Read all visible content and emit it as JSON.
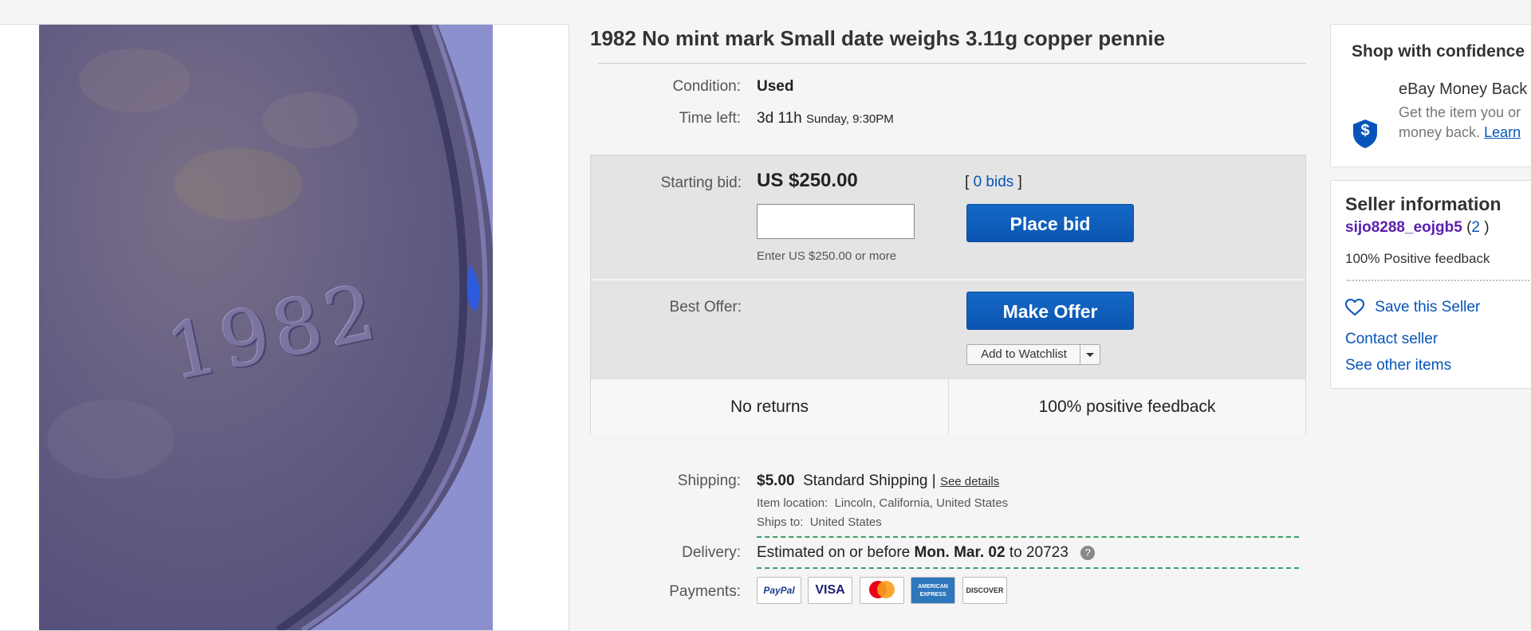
{
  "item": {
    "title": "1982 No mint mark Small date weighs 3.11g copper pennie",
    "photo_text": "1982",
    "condition_label": "Condition:",
    "condition_value": "Used",
    "time_left_label": "Time left:",
    "time_left_value": "3d 11h",
    "time_left_end": "Sunday, 9:30PM"
  },
  "bidding": {
    "starting_bid_label": "Starting bid:",
    "starting_bid_value": "US $250.00",
    "bids_open": "[",
    "bids_link": "0 bids",
    "bids_close": "]",
    "input_hint": "Enter US $250.00 or more",
    "place_bid_label": "Place bid",
    "best_offer_label": "Best Offer:",
    "make_offer_label": "Make Offer",
    "watchlist_label": "Add to Watchlist",
    "returns_text": "No returns",
    "feedback_text": "100% positive feedback"
  },
  "shipping": {
    "shipping_label": "Shipping:",
    "cost": "$5.00",
    "method": "Standard Shipping",
    "separator": "|",
    "details_link": "See details",
    "location_label": "Item location:",
    "location_value": "Lincoln, California, United States",
    "ships_to_label": "Ships to:",
    "ships_to_value": "United States",
    "delivery_label": "Delivery:",
    "delivery_prefix": "Estimated on or before",
    "delivery_date": "Mon. Mar. 02",
    "delivery_to": "to 20723",
    "help_glyph": "?",
    "payments_label": "Payments:",
    "payment_methods": [
      "PayPal",
      "VISA",
      "mastercard",
      "AMERICAN EXPRESS",
      "DISCOVER"
    ]
  },
  "confidence": {
    "heading": "Shop with confidence",
    "guarantee_title": "eBay Money Back",
    "guarantee_line1": "Get the item you or",
    "guarantee_line2": "money back.",
    "learn_link": "Learn",
    "shield_glyph": "$"
  },
  "seller": {
    "heading": "Seller information",
    "username": "sijo8288_eojgb5",
    "score_open": "(",
    "score": "2",
    "score_close": ")",
    "feedback": "100% Positive feedback",
    "save_label": "Save this Seller",
    "contact_label": "Contact seller",
    "other_items_label": "See other items"
  },
  "colors": {
    "accent": "#0654ba",
    "button": "#0a55b0",
    "seller_name": "#5a1fae",
    "delivery_dash": "#3aa06a"
  }
}
